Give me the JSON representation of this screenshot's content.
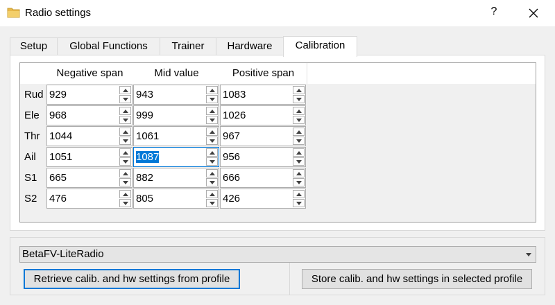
{
  "window": {
    "title": "Radio settings",
    "help_label": "?"
  },
  "tabs": [
    {
      "label": "Setup"
    },
    {
      "label": "Global Functions"
    },
    {
      "label": "Trainer"
    },
    {
      "label": "Hardware"
    },
    {
      "label": "Calibration",
      "active": true
    }
  ],
  "calibration": {
    "columns": [
      "Negative span",
      "Mid value",
      "Positive span"
    ],
    "rows": [
      {
        "label": "Rud",
        "values": [
          "929",
          "943",
          "1083"
        ]
      },
      {
        "label": "Ele",
        "values": [
          "968",
          "999",
          "1026"
        ]
      },
      {
        "label": "Thr",
        "values": [
          "1044",
          "1061",
          "967"
        ]
      },
      {
        "label": "Ail",
        "values": [
          "1051",
          "1087",
          "956"
        ]
      },
      {
        "label": "S1",
        "values": [
          "665",
          "882",
          "666"
        ]
      },
      {
        "label": "S2",
        "values": [
          "476",
          "805",
          "426"
        ]
      }
    ],
    "focused_cell": {
      "row": 3,
      "col": 1
    }
  },
  "profile": {
    "selected": "BetaFV-LiteRadio"
  },
  "buttons": {
    "retrieve": "Retrieve calib. and hw settings from profile",
    "store": "Store calib. and hw settings in selected profile"
  },
  "colors": {
    "accent": "#0078d7",
    "folder_icon": "#e8b84a"
  }
}
